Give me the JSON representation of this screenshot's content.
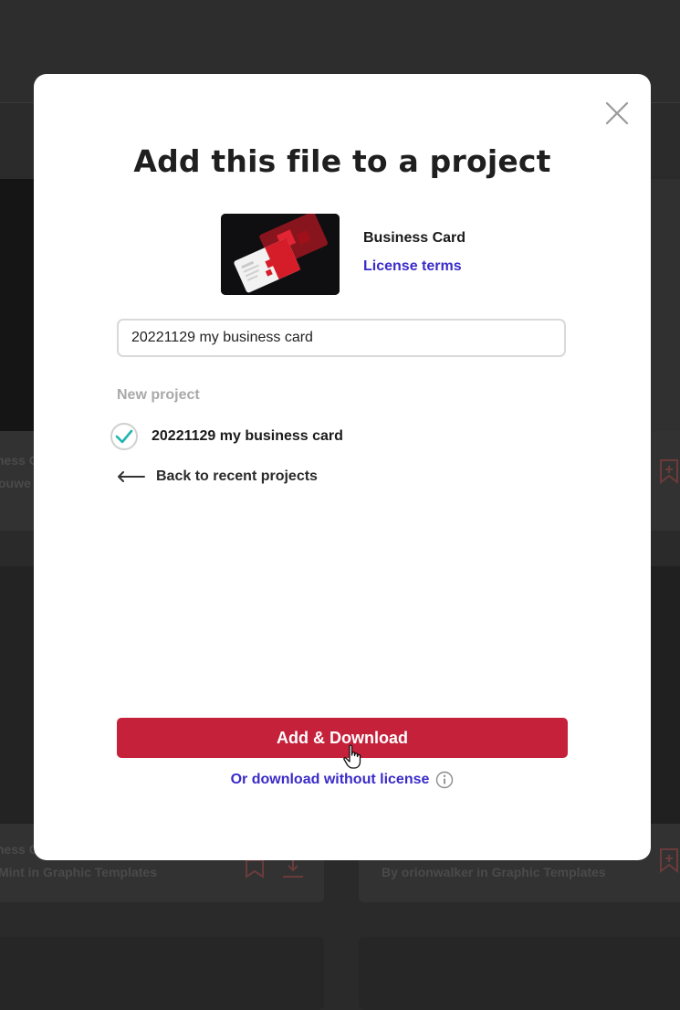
{
  "modal": {
    "title": "Add this file to a project",
    "file": {
      "name": "Business Card",
      "license_link": "License terms",
      "thumbnail_icon": "business-card-thumbnail"
    },
    "project_input": {
      "value": "20221129 my business card"
    },
    "section_label": "New project",
    "selected_project": {
      "name": "20221129 my business card",
      "checked": true
    },
    "back_link": "Back to recent projects",
    "primary_button": "Add & Download",
    "secondary_link": "Or download without license",
    "colors": {
      "primary": "#c5213b",
      "link": "#3a2bc9",
      "check": "#1fb5ae"
    }
  },
  "background": {
    "cards": [
      {
        "title_fragment": "ness C",
        "author_fragment": "ouwe"
      },
      {
        "title_fragment": "ness C",
        "author_fragment": "Mint in Graphic Templates"
      },
      {
        "author_fragment": "By orionwalker in Graphic Templates"
      }
    ]
  }
}
